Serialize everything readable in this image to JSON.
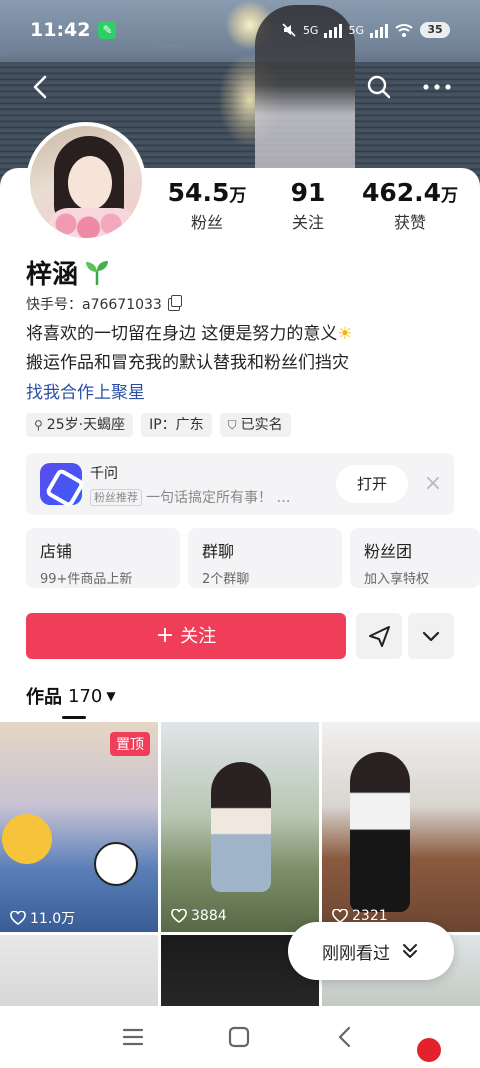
{
  "status_bar": {
    "time": "11:42",
    "net1": "5G",
    "net2": "5G",
    "battery": "35"
  },
  "profile": {
    "stats": [
      {
        "value": "54.5",
        "unit": "万",
        "label": "粉丝"
      },
      {
        "value": "91",
        "unit": "",
        "label": "关注"
      },
      {
        "value": "462.4",
        "unit": "万",
        "label": "获赞"
      }
    ],
    "name": "梓涵",
    "id_text": "快手号：a76671033",
    "bio_line1": "将喜欢的一切留在身边 这便是努力的意义",
    "bio_line1_emoji": "☀",
    "bio_line2": "搬运作品和冒充我的默认替我和粉丝们挡灾",
    "link_text": "找我合作上聚星",
    "tags": [
      "25岁·天蝎座",
      "IP：广东",
      "已实名"
    ]
  },
  "promo": {
    "name": "千问",
    "badge": "粉丝推荐",
    "desc": "一句话搞定所有事！ …",
    "open_label": "打开"
  },
  "cards": [
    {
      "title": "店铺",
      "sub": "99+件商品上新"
    },
    {
      "title": "群聊",
      "sub": "2个群聊"
    },
    {
      "title": "粉丝团",
      "sub": "加入享特权"
    }
  ],
  "actions": {
    "follow_label": "关注"
  },
  "works": {
    "label": "作品",
    "count": "170"
  },
  "tiles": [
    {
      "likes": "11.0万",
      "pinned_label": "置顶"
    },
    {
      "likes": "3884"
    },
    {
      "likes": "2321"
    }
  ],
  "float_pill": {
    "label": "刚刚看过"
  },
  "colors": {
    "accent": "#ef3d5a",
    "link": "#2b4fa8",
    "record_dot": "#e3222d"
  }
}
